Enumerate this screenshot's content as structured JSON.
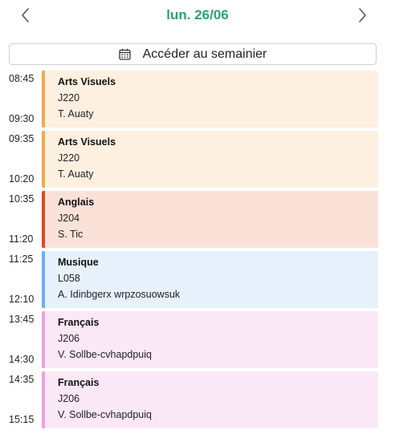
{
  "header": {
    "prev_icon": "chevron-left-icon",
    "next_icon": "chevron-right-icon",
    "date": "lun. 26/06",
    "date_color": "#2aa17e"
  },
  "week_button": {
    "icon": "calendar-icon",
    "label": "Accéder au semainier"
  },
  "lessons": [
    {
      "start": "08:45",
      "end": "09:30",
      "subject": "Arts Visuels",
      "room": "J220",
      "teacher": "T. Auaty",
      "bg": "#fdf0e1",
      "accent": "#f2a950"
    },
    {
      "start": "09:35",
      "end": "10:20",
      "subject": "Arts Visuels",
      "room": "J220",
      "teacher": "T. Auaty",
      "bg": "#fdf0e1",
      "accent": "#f2a950"
    },
    {
      "start": "10:35",
      "end": "11:20",
      "subject": "Anglais",
      "room": "J204",
      "teacher": "S. Tic",
      "bg": "#fae2d9",
      "accent": "#dc4a1e"
    },
    {
      "start": "11:25",
      "end": "12:10",
      "subject": "Musique",
      "room": "L058",
      "teacher": "A. Idinbgerx wrpzosuowsuk",
      "bg": "#e6f1fb",
      "accent": "#6aaef0"
    },
    {
      "start": "13:45",
      "end": "14:30",
      "subject": "Français",
      "room": "J206",
      "teacher": "V. Sollbe-cvhapdpuiq",
      "bg": "#fbe8f7",
      "accent": "#eaa2dd"
    },
    {
      "start": "14:35",
      "end": "15:15",
      "subject": "Français",
      "room": "J206",
      "teacher": "V. Sollbe-cvhapdpuiq",
      "bg": "#fbe8f7",
      "accent": "#eaa2dd"
    }
  ]
}
